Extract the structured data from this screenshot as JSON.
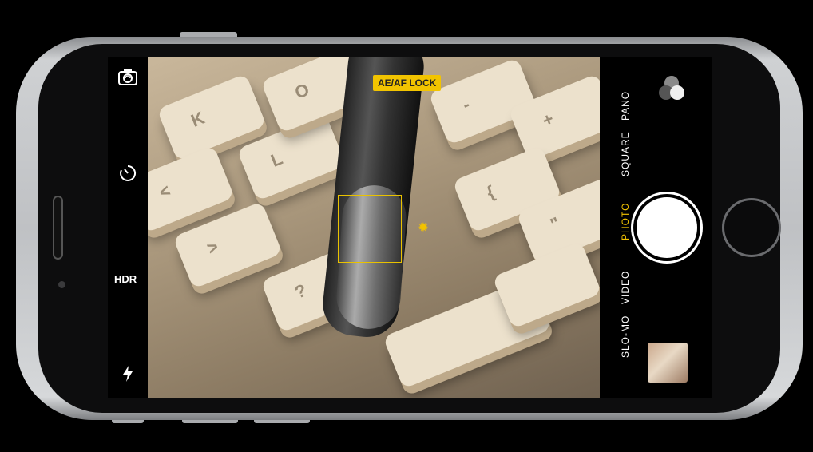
{
  "camera": {
    "lock_badge": "AE/AF LOCK",
    "hdr_label": "HDR",
    "modes": [
      {
        "label": "SLO-MO",
        "active": false
      },
      {
        "label": "VIDEO",
        "active": false
      },
      {
        "label": "PHOTO",
        "active": true
      },
      {
        "label": "SQUARE",
        "active": false
      },
      {
        "label": "PANO",
        "active": false
      }
    ],
    "icons": {
      "flip": "camera-flip-icon",
      "timer": "timer-icon",
      "flash": "flash-icon",
      "filters": "filters-icon"
    },
    "accent_color": "#f2c200"
  },
  "keyboard_keys": [
    "K",
    "L",
    "O",
    "<",
    ">",
    "?",
    "-",
    "+",
    "{",
    "\""
  ]
}
